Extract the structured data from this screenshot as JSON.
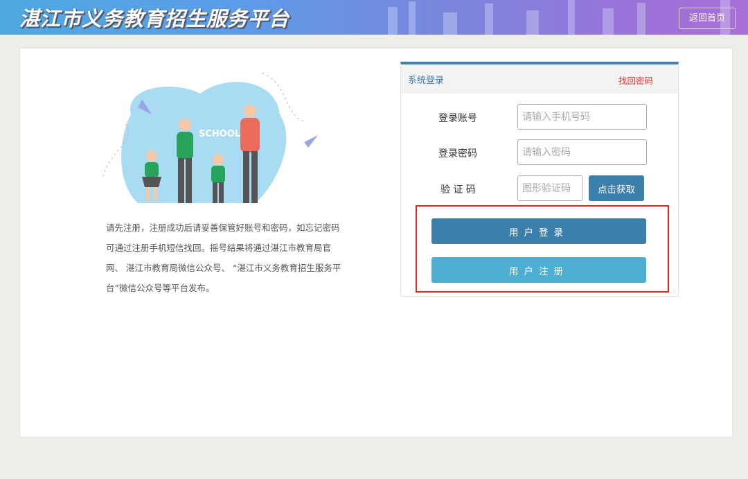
{
  "header": {
    "title": "湛江市义务教育招生服务平台",
    "home_button": "返回首页"
  },
  "illustration": {
    "sign_text": "SCHOOL"
  },
  "notice": "请先注册，注册成功后请妥善保管好账号和密码，如忘记密码可通过注册手机短信找回。摇号结果将通过湛江市教育局官网、 湛江市教育局微信公众号、 “湛江市义务教育招生服务平台”微信公众号等平台发布。",
  "login": {
    "title": "系统登录",
    "forgot_link": "找回密码",
    "account_label": "登录账号",
    "account_placeholder": "请输入手机号码",
    "password_label": "登录密码",
    "password_placeholder": "请输入密码",
    "captcha_label": "验 证 码",
    "captcha_placeholder": "图形验证码",
    "get_code_button": "点击获取",
    "login_button": "用户登录",
    "register_button": "用户注册"
  },
  "colors": {
    "primary": "#3b80ac",
    "secondary": "#4caed2",
    "highlight": "#e5231c",
    "link": "#e33333"
  }
}
